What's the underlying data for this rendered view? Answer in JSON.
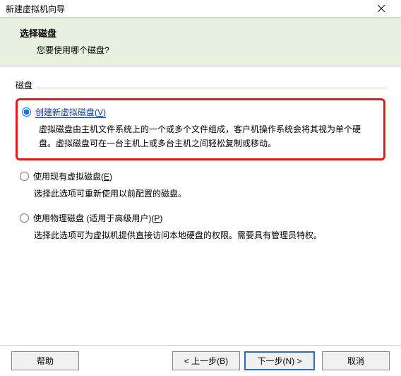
{
  "window": {
    "title": "新建虚拟机向导"
  },
  "header": {
    "title": "选择磁盘",
    "subtitle": "您要使用哪个磁盘?"
  },
  "fieldset": {
    "label": "磁盘"
  },
  "options": {
    "create": {
      "label_prefix": "创建新虚拟磁盘(",
      "mnemonic": "V",
      "label_suffix": ")",
      "desc": "虚拟磁盘由主机文件系统上的一个或多个文件组成，客户机操作系统会将其视为单个硬盘。虚拟磁盘可在一台主机上或多台主机之间轻松复制或移动。"
    },
    "existing": {
      "label_prefix": "使用现有虚拟磁盘(",
      "mnemonic": "E",
      "label_suffix": ")",
      "desc": "选择此选项可重新使用以前配置的磁盘。"
    },
    "physical": {
      "label_prefix": "使用物理磁盘 (适用于高级用户)(",
      "mnemonic": "P",
      "label_suffix": ")",
      "desc": "选择此选项可为虚拟机提供直接访问本地硬盘的权限。需要具有管理员特权。"
    }
  },
  "buttons": {
    "help": "帮助",
    "back": "< 上一步(B)",
    "next": "下一步(N) >",
    "cancel": "取消"
  }
}
